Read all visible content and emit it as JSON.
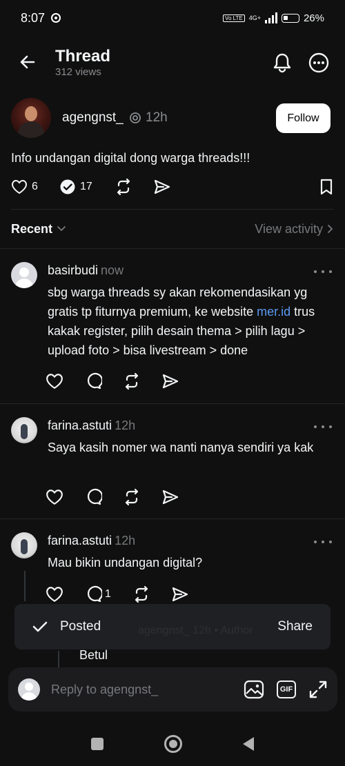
{
  "status": {
    "time": "8:07",
    "network": "4G+",
    "volte": "Vo LTE",
    "battery": "26%"
  },
  "header": {
    "title": "Thread",
    "views": "312 views"
  },
  "post": {
    "username": "agengnst_",
    "time": "12h",
    "follow_label": "Follow",
    "text": "Info undangan digital dong warga threads!!!",
    "likes": "6",
    "replies": "17"
  },
  "sort": {
    "label": "Recent",
    "view_activity": "View activity"
  },
  "replies": [
    {
      "username": "basirbudi",
      "time": "now",
      "text_before": "sbg warga threads sy akan rekomendasikan yg gratis tp fiturnya premium, ke website ",
      "link": "mer.id",
      "text_after": " trus kakak register, pilih desain thema > pilih lagu > upload foto > bisa livestream > done"
    },
    {
      "username": "farina.astuti",
      "time": "12h",
      "text": "Saya kasih nomer wa nanti nanya sendiri ya kak"
    },
    {
      "username": "farina.astuti",
      "time": "12h",
      "text": "Mau bikin undangan digital?",
      "reply_count": "1"
    }
  ],
  "toast": {
    "label": "Posted",
    "action": "Share",
    "behind_text": "agengnst_  12h • Author"
  },
  "nested": {
    "text": "Betul"
  },
  "composer": {
    "placeholder": "Reply to agengnst_",
    "gif_label": "GIF"
  },
  "colors": {
    "background": "#101010",
    "text": "#f3f5f7",
    "muted": "#77797c",
    "link": "#5b9bf1"
  }
}
